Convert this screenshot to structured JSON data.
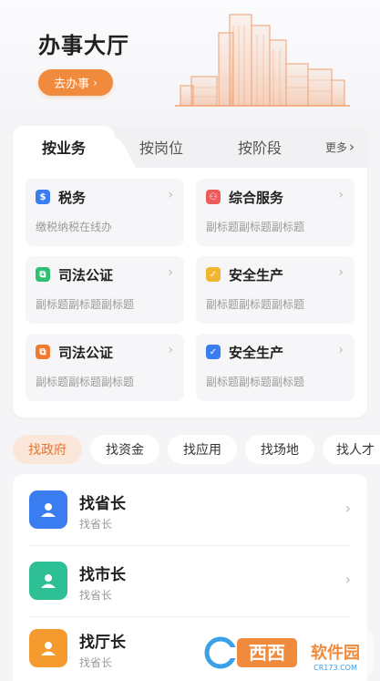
{
  "header": {
    "title": "办事大厅",
    "go_button_label": "去办事",
    "go_button_chevron": "›",
    "illustration_icon": "city-skyline-illustration"
  },
  "tabs": [
    {
      "label": "按业务",
      "active": true
    },
    {
      "label": "按岗位",
      "active": false
    },
    {
      "label": "按阶段",
      "active": false
    }
  ],
  "more_label": "更多",
  "more_chevron": "›",
  "tiles": [
    {
      "title": "税务",
      "subtitle": "缴税纳税在线办",
      "icon": "tax-icon",
      "icon_glyph": "$",
      "color": "#3a7df0"
    },
    {
      "title": "综合服务",
      "subtitle": "副标题副标题副标题",
      "icon": "service-people-icon",
      "icon_glyph": "⚇",
      "color": "#ec5a5a"
    },
    {
      "title": "司法公证",
      "subtitle": "副标题副标题副标题",
      "icon": "notary-icon",
      "icon_glyph": "⧉",
      "color": "#2fbf71"
    },
    {
      "title": "安全生产",
      "subtitle": "副标题副标题副标题",
      "icon": "safety-shield-icon",
      "icon_glyph": "✓",
      "color": "#f2b52f"
    },
    {
      "title": "司法公证",
      "subtitle": "副标题副标题副标题",
      "icon": "notary-icon",
      "icon_glyph": "⧉",
      "color": "#f07a2f"
    },
    {
      "title": "安全生产",
      "subtitle": "副标题副标题副标题",
      "icon": "safety-shield-icon",
      "icon_glyph": "✓",
      "color": "#3a7df0"
    }
  ],
  "tile_chevron": "›",
  "filters": [
    {
      "label": "找政府",
      "active": true
    },
    {
      "label": "找资金",
      "active": false
    },
    {
      "label": "找应用",
      "active": false
    },
    {
      "label": "找场地",
      "active": false
    },
    {
      "label": "找人才",
      "active": false
    }
  ],
  "list": [
    {
      "title": "找省长",
      "subtitle": "找省长",
      "icon": "person-icon",
      "color": "#3a7df0"
    },
    {
      "title": "找市长",
      "subtitle": "找省长",
      "icon": "person-icon",
      "color": "#2fbf95"
    },
    {
      "title": "找厅长",
      "subtitle": "找省长",
      "icon": "person-icon",
      "color": "#f59a2f"
    }
  ],
  "list_chevron": "›",
  "watermark": {
    "brand": "西西软件园",
    "url": "CR173.COM"
  },
  "colors": {
    "accent": "#f08a3c",
    "background": "#f5f5f7"
  }
}
